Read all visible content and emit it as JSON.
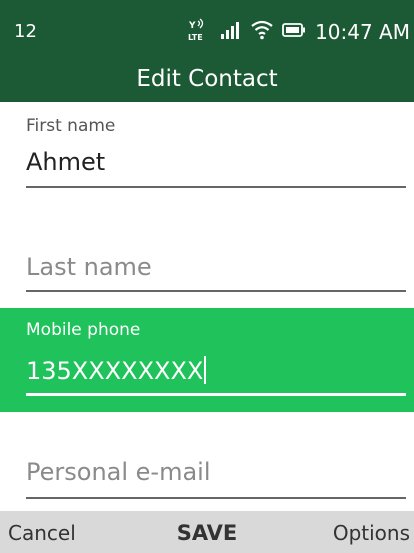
{
  "status_bar": {
    "notification_count": "12",
    "network_icon_label": "LTE",
    "time": "10:47 AM"
  },
  "header": {
    "title": "Edit Contact"
  },
  "form": {
    "first_name": {
      "label": "First name",
      "value": "Ahmet"
    },
    "last_name": {
      "placeholder": "Last name"
    },
    "mobile_phone": {
      "label": "Mobile phone",
      "value": "135XXXXXXXX"
    },
    "personal_email": {
      "placeholder": "Personal e-mail"
    }
  },
  "softkeys": {
    "left": "Cancel",
    "center": "SAVE",
    "right": "Options"
  },
  "colors": {
    "header_bg": "#1b5a35",
    "focus_bg": "#1fc25b",
    "softkey_bg": "#d9d9d9"
  },
  "icons": [
    "volte-lte-icon",
    "signal-icon",
    "wifi-icon",
    "battery-icon"
  ]
}
